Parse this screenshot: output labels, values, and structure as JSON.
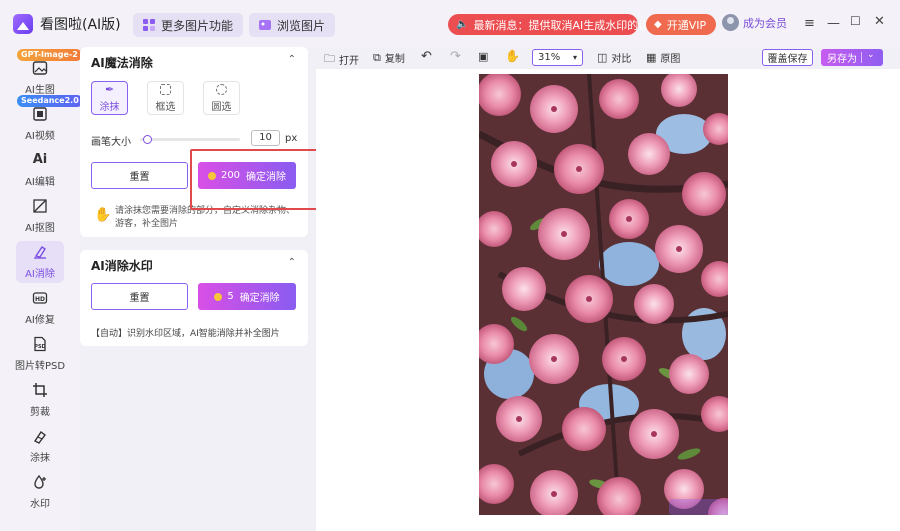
{
  "window": {
    "title": "看图啦(AI版)",
    "more_features": "更多图片功能",
    "browse": "浏览图片",
    "news": "最新消息：提供取消AI生成水印的设置",
    "vip": "开通VIP",
    "member": "成为会员"
  },
  "nav": {
    "tag_gpt": "GPT-Image-2",
    "tag_seedance": "Seedance2.0",
    "items": [
      {
        "label": "AI生图",
        "icon": "image-icon"
      },
      {
        "label": "AI视频",
        "icon": "video-icon"
      },
      {
        "label": "AI编辑",
        "icon": "ai-edit-icon"
      },
      {
        "label": "AI抠图",
        "icon": "cutout-icon"
      },
      {
        "label": "AI消除",
        "icon": "eraser-icon"
      },
      {
        "label": "AI修复",
        "icon": "hd-icon"
      },
      {
        "label": "图片转PSD",
        "icon": "psd-icon"
      },
      {
        "label": "剪裁",
        "icon": "crop-icon"
      },
      {
        "label": "涂抹",
        "icon": "smear-icon"
      },
      {
        "label": "水印",
        "icon": "watermark-icon"
      }
    ],
    "active_index": 4
  },
  "magic_erase": {
    "title": "AI魔法消除",
    "tools": [
      "涂抹",
      "框选",
      "圆选"
    ],
    "active_tool": 0,
    "brush_label": "画笔大小",
    "brush_value": "10",
    "brush_unit": "px",
    "brush_level": 0.05,
    "reset": "重置",
    "confirm_cost": "200",
    "confirm": "确定消除",
    "hint": "请涂抹您需要消除的部分，自定义消除杂物、游客，补全图片"
  },
  "watermark_erase": {
    "title": "AI消除水印",
    "reset": "重置",
    "confirm_cost": "5",
    "confirm": "确定消除",
    "note": "【自动】识别水印区域，AI智能消除并补全图片"
  },
  "toolbar": {
    "open": "打开",
    "copy": "复制",
    "zoom": "31%",
    "compare": "对比",
    "original": "原图",
    "save_cover": "覆盖保存",
    "save_as": "另存为"
  },
  "colors": {
    "accent": "#8a5cf0",
    "gradient_start": "#d94fe6",
    "news_red": "#ec4d50",
    "vip_orange": "#f06a4f",
    "highlight_red": "#e14a4a"
  }
}
